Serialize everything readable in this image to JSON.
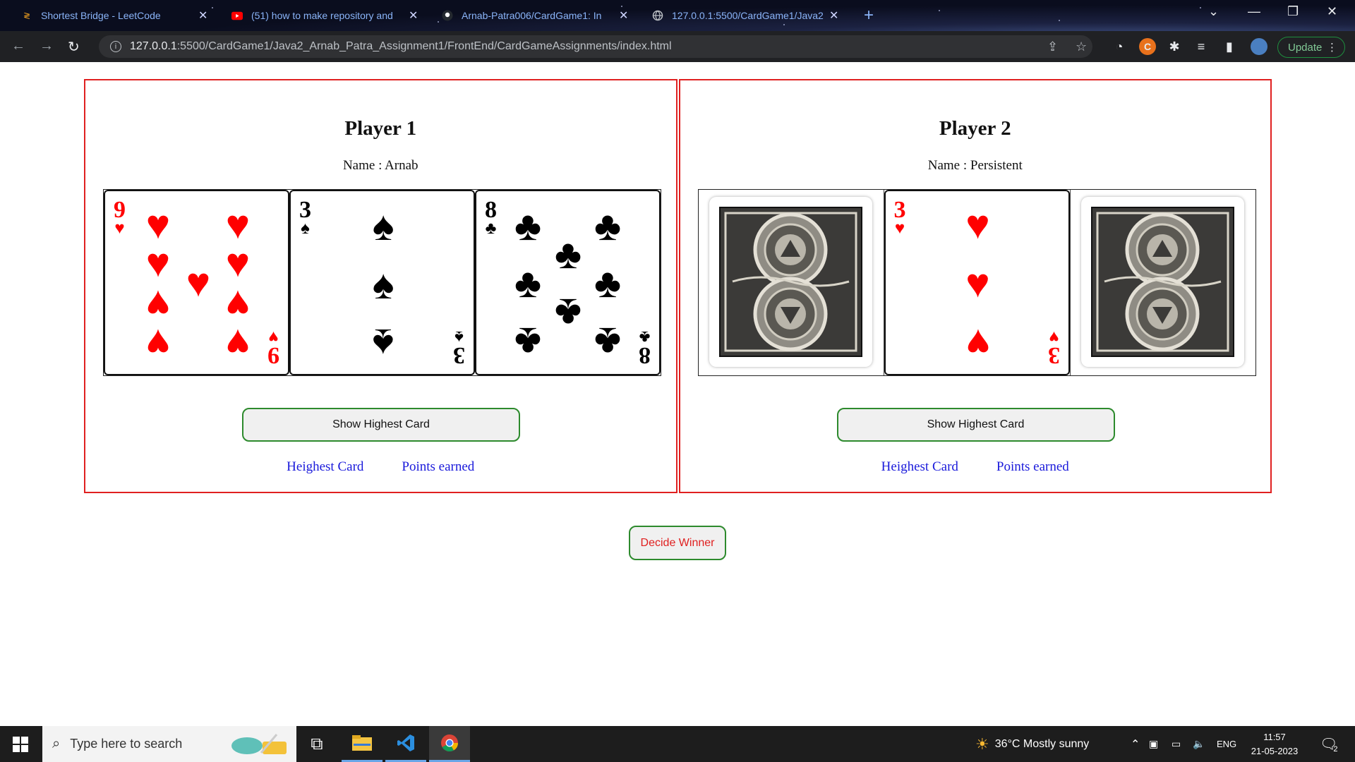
{
  "browser": {
    "tabs": [
      {
        "title": "Shortest Bridge - LeetCode",
        "icon": "leetcode-icon"
      },
      {
        "title": "(51) how to make repository and",
        "icon": "youtube-icon"
      },
      {
        "title": "Arnab-Patra006/CardGame1: In",
        "icon": "github-icon"
      },
      {
        "title": "127.0.0.1:5500/CardGame1/Java2",
        "icon": "globe-icon"
      }
    ],
    "url_host": "127.0.0.1",
    "url_rest": ":5500/CardGame1/Java2_Arnab_Patra_Assignment1/FrontEnd/CardGameAssignments/index.html",
    "update_label": "Update"
  },
  "players": [
    {
      "title": "Player 1",
      "name_text": "Name : Arnab",
      "cards": [
        {
          "rank": "9",
          "suit": "♥",
          "color": "red",
          "face_down": false
        },
        {
          "rank": "3",
          "suit": "♠",
          "color": "black",
          "face_down": false
        },
        {
          "rank": "8",
          "suit": "♣",
          "color": "black",
          "face_down": false
        }
      ],
      "show_button": "Show Highest Card",
      "highest_label": "Heighest Card",
      "points_label": "Points earned"
    },
    {
      "title": "Player 2",
      "name_text": "Name : Persistent",
      "cards": [
        {
          "face_down": true
        },
        {
          "rank": "3",
          "suit": "♥",
          "color": "red",
          "face_down": false
        },
        {
          "face_down": true
        }
      ],
      "show_button": "Show Highest Card",
      "highest_label": "Heighest Card",
      "points_label": "Points earned"
    }
  ],
  "decide_button": "Decide Winner",
  "taskbar": {
    "search_placeholder": "Type here to search",
    "weather": "36°C  Mostly sunny",
    "language": "ENG",
    "time": "11:57",
    "date": "21-05-2023",
    "notification_count": "2"
  }
}
